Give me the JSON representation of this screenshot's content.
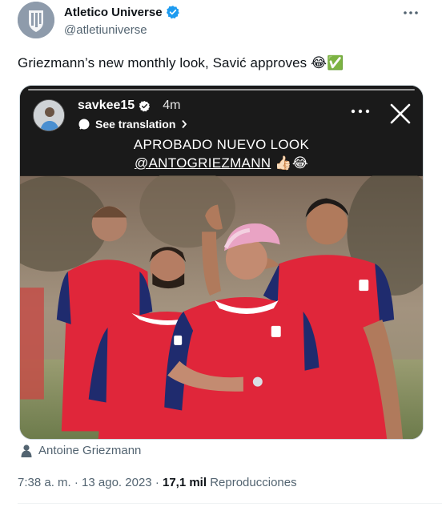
{
  "author": {
    "display_name": "Atletico Universe",
    "handle": "@atletiuniverse",
    "verified": true
  },
  "tweet": {
    "text": "Griezmann’s new monthly look, Savić approves 😂✅"
  },
  "story": {
    "username": "savkee15",
    "time": "4m",
    "see_translation": "See translation",
    "caption_line1": "APROBADO NUEVO LOOK",
    "caption_line2": "@ANTOGRIEZMANN",
    "caption_emoji": "👍🏻😂"
  },
  "tagged_person": "Antoine Griezmann",
  "meta": {
    "time": "7:38 a. m.",
    "separator": "·",
    "date": "13 ago. 2023",
    "views_count": "17,1 mil",
    "views_label": "Reproducciones"
  },
  "colors": {
    "verified_blue": "#1d9bf0",
    "secondary_text": "#536471",
    "kit_red": "#e0263a",
    "kit_navy": "#1f2b6e"
  },
  "icons": {
    "verified": "verified-badge-icon",
    "more": "more-horizontal-icon",
    "close": "close-icon",
    "person": "person-icon"
  }
}
